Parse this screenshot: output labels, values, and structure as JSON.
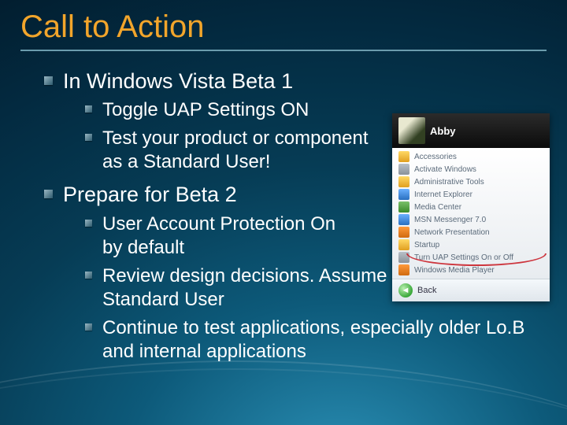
{
  "title": "Call to Action",
  "bullets": [
    {
      "text": "In Windows Vista Beta 1",
      "sub": [
        "Toggle UAP Settings ON",
        "Test your product or component as a Standard User!"
      ]
    },
    {
      "text": "Prepare for Beta 2",
      "sub": [
        "User Account Protection On by default",
        "Review design decisions.  Assume the user is a Standard User",
        "Continue to test applications, especially older Lo.B and internal applications"
      ]
    }
  ],
  "inset": {
    "user": "Abby",
    "items": [
      "Accessories",
      "Activate Windows",
      "Administrative Tools",
      "Internet Explorer",
      "Media Center",
      "MSN Messenger 7.0",
      "Network Presentation",
      "Startup",
      "Turn UAP Settings On or Off",
      "Windows Media Player"
    ],
    "back": "Back"
  }
}
